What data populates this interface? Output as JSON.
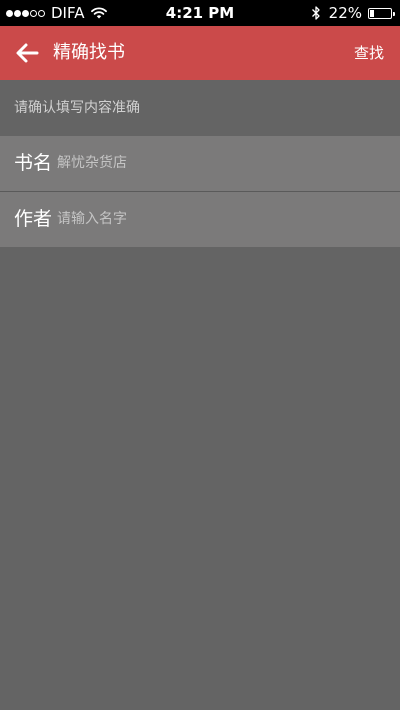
{
  "status_bar": {
    "carrier": "DIFA",
    "time": "4:21 PM",
    "battery_percent": "22%",
    "battery_level": 0.22,
    "signal_bars_filled": 3,
    "signal_bars_total": 5
  },
  "nav": {
    "title": "精确找书",
    "action_label": "查找",
    "back_icon": "arrow-left-icon",
    "background_color": "#cb4a4a"
  },
  "form": {
    "hint": "请确认填写内容准确",
    "fields": [
      {
        "label": "书名",
        "value": "解忧杂货店",
        "placeholder": ""
      },
      {
        "label": "作者",
        "value": "",
        "placeholder": "请输入名字"
      }
    ]
  },
  "colors": {
    "page_background": "#646464",
    "field_background": "#7b7a7a",
    "accent": "#cb4a4a"
  }
}
